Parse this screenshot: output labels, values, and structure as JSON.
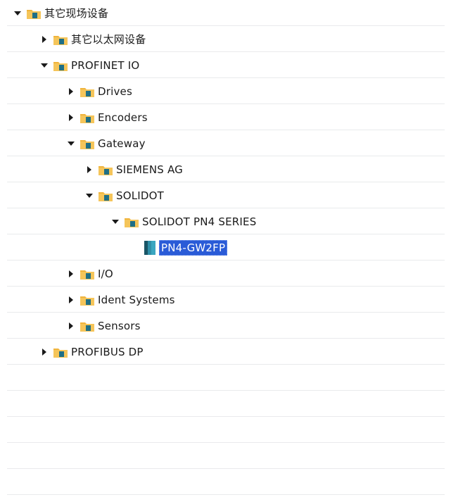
{
  "tree": {
    "root": {
      "label": "其它现场设备",
      "icon": "folder-icon",
      "expanded": true
    },
    "items": [
      {
        "label": "其它以太网设备",
        "expanded": false
      },
      {
        "label": "PROFINET IO",
        "expanded": true
      },
      {
        "label": "Drives",
        "expanded": false
      },
      {
        "label": "Encoders",
        "expanded": false
      },
      {
        "label": "Gateway",
        "expanded": true
      },
      {
        "label": "SIEMENS AG",
        "expanded": false
      },
      {
        "label": "SOLIDOT",
        "expanded": true
      },
      {
        "label": "SOLIDOT PN4 SERIES",
        "expanded": true
      },
      {
        "label": "PN4-GW2FP",
        "icon": "device-module-icon",
        "selected": true
      },
      {
        "label": "I/O",
        "expanded": false
      },
      {
        "label": "Ident Systems",
        "expanded": false
      },
      {
        "label": "Sensors",
        "expanded": false
      },
      {
        "label": "PROFIBUS DP",
        "expanded": false
      }
    ]
  },
  "colors": {
    "selection": "#2a5bd7",
    "folder": "#f0b43c",
    "device": "#1f6f86"
  }
}
